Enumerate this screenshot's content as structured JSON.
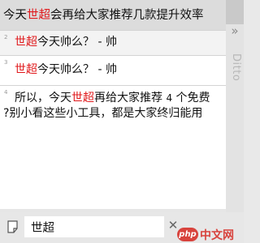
{
  "app": {
    "side_label": "Ditto",
    "collapse_glyph": "»"
  },
  "items": [
    {
      "index": "",
      "segments": [
        "今天",
        "世超",
        "会再给大家推荐几款提升效率"
      ]
    },
    {
      "index": "2",
      "segments": [
        "世超",
        "今天帅么？ - 帅"
      ]
    },
    {
      "index": "3",
      "segments": [
        "世超",
        "今天帅么？ - 帅"
      ]
    },
    {
      "index": "4",
      "line1_segments": [
        "所以，今天",
        "世超",
        "再给大家推荐 ",
        "4",
        " 个免费"
      ],
      "line2": "?别小看这些小工具，都是大家终归能用"
    }
  ],
  "search": {
    "value": "世超",
    "clear_glyph": "✕"
  },
  "watermark": {
    "badge": "php",
    "text": "中文网"
  },
  "colors": {
    "highlight": "#e0181b",
    "selected_row": "#dcdcdc",
    "brand": "#d8433d"
  },
  "icons": [
    "note-icon",
    "clear-icon",
    "more-icon",
    "collapse-icon"
  ]
}
